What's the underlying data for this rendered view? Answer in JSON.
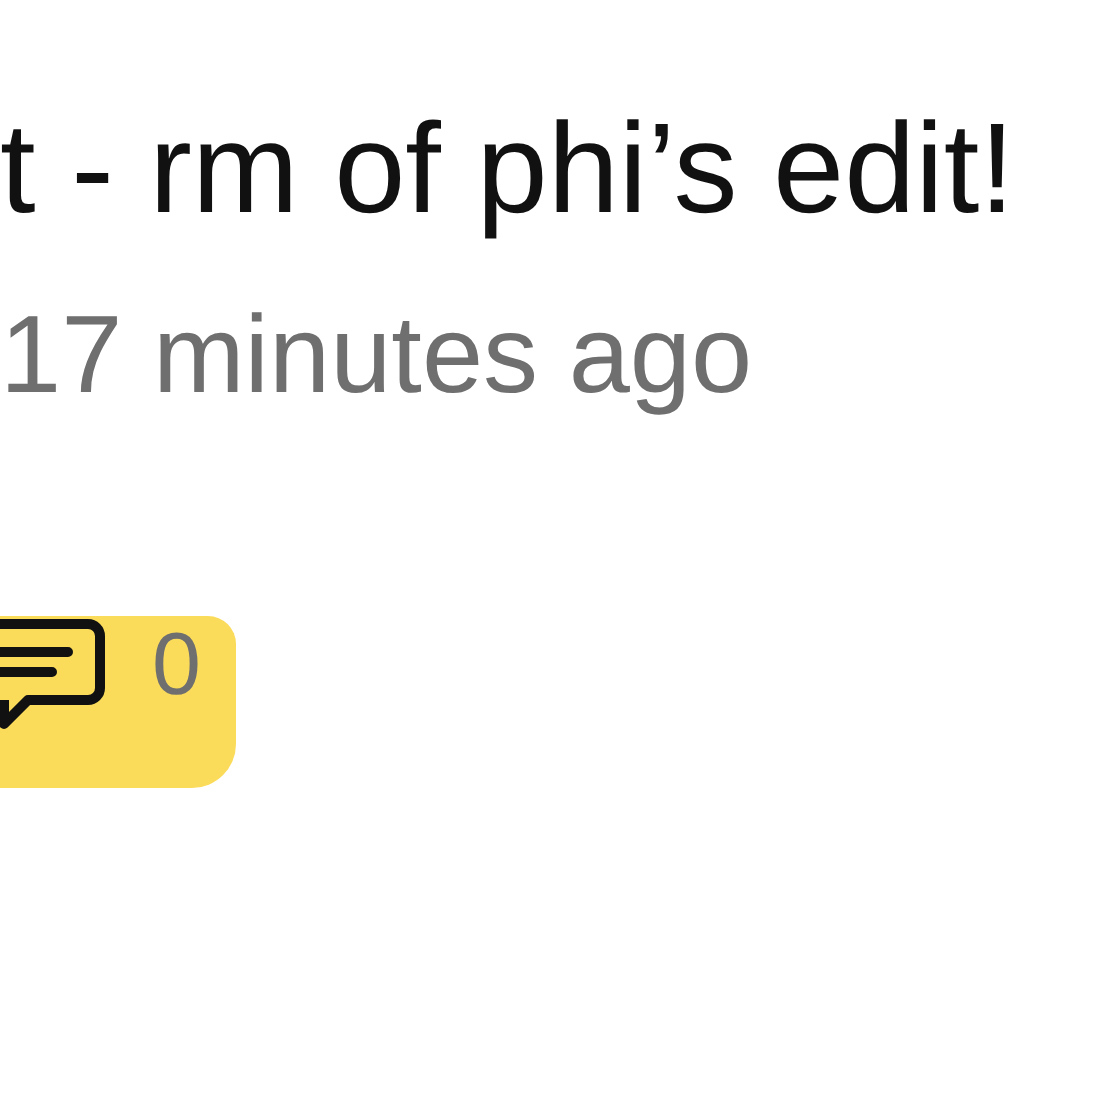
{
  "post": {
    "title": "t - rm of phi’s edit!",
    "time": "17 minutes ago"
  },
  "comments": {
    "count": "0",
    "highlighted": true
  }
}
